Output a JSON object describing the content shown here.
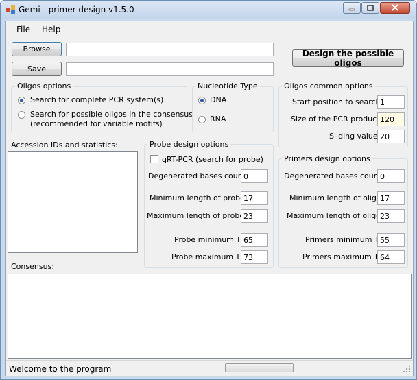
{
  "window": {
    "title": "Gemi - primer design v1.5.0"
  },
  "menu": [
    "File",
    "Help"
  ],
  "top": {
    "browse_label": "Browse",
    "save_label": "Save",
    "browse_path": "",
    "save_path": "",
    "design_label": "Design the possible oligos"
  },
  "oligos_options": {
    "title": "Oligos options",
    "option_complete": "Search for complete PCR system(s)",
    "option_consensus_1": "Search for possible oligos in the consensus",
    "option_consensus_2": "(recommended for variable motifs)",
    "selected": "complete"
  },
  "nucleotide": {
    "title": "Nucleotide Type",
    "dna": "DNA",
    "rna": "RNA",
    "selected": "DNA"
  },
  "common_options": {
    "title": "Oligos common options",
    "start_label": "Start position to search",
    "start_value": "1",
    "size_label": "Size of the PCR product",
    "size_value": "120",
    "sliding_label": "Sliding value",
    "sliding_value": "20"
  },
  "accession": {
    "title": "Accession IDs and statistics:"
  },
  "probe": {
    "title": "Probe design options",
    "qrt_label": "qRT-PCR (search for probe)",
    "qrt_checked": false,
    "degen_label": "Degenerated bases count",
    "degen_value": "0",
    "minlen_label": "Minimum length of probes",
    "minlen_value": "17",
    "maxlen_label": "Maximum length of probes",
    "maxlen_value": "23",
    "mintd_label": "Probe minimum Td",
    "mintd_value": "65",
    "maxtd_label": "Probe maximum Td",
    "maxtd_value": "73"
  },
  "primers": {
    "title": "Primers design options",
    "degen_label": "Degenerated bases count",
    "degen_value": "0",
    "minlen_label": "Minimum length of oligos",
    "minlen_value": "17",
    "maxlen_label": "Maximum length of oligos",
    "maxlen_value": "23",
    "mintd_label": "Primers minimum Td",
    "mintd_value": "55",
    "maxtd_label": "Primers maximum Td",
    "maxtd_value": "64"
  },
  "consensus": {
    "title": "Consensus:"
  },
  "status": {
    "text": "Welcome to the program"
  },
  "colors": {
    "title_bar": "#c9d9ec",
    "close_button": "#c6472f",
    "highlight_field": "#fffbe5"
  }
}
